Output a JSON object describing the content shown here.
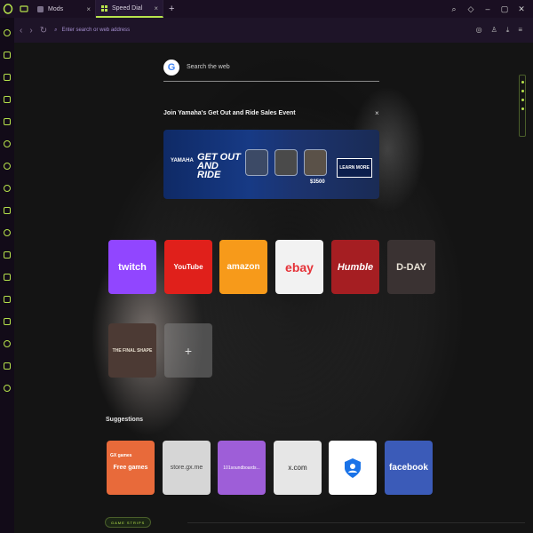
{
  "tabs": [
    {
      "title": "Mods",
      "close": "×"
    },
    {
      "title": "Speed Dial",
      "close": "×"
    }
  ],
  "new_tab": "+",
  "address_bar": {
    "placeholder": "Enter search or web address"
  },
  "search": {
    "placeholder": "Search the web",
    "engine_letter": "G"
  },
  "ad": {
    "title": "Join Yamaha's Get Out and Ride Sales Event",
    "close": "×",
    "brand": "YAMAHA",
    "headline": "GET OUT AND RIDE",
    "offer": "$3500",
    "cta": "LEARN MORE"
  },
  "speed_dial": [
    {
      "label": "twitch",
      "bg": "#9146ff",
      "color": "#ffffff"
    },
    {
      "label": "YouTube",
      "bg": "#e0201b",
      "color": "#ffffff"
    },
    {
      "label": "amazon",
      "bg": "#f79a1a",
      "color": "#ffffff"
    },
    {
      "label": "ebay",
      "bg": "#f2f2f2",
      "color": "#e53238"
    },
    {
      "label": "Humble",
      "bg": "#a51e22",
      "color": "#ffffff"
    },
    {
      "label": "D-DAY",
      "bg": "#3a3232",
      "color": "#e8e2d6"
    },
    {
      "label": "THE FINAL SHAPE",
      "bg": "#4c3a34",
      "color": "#e9e0d0"
    }
  ],
  "add_tile": "+",
  "suggestions_label": "Suggestions",
  "suggestions": [
    {
      "label": "Free games",
      "bg": "#e86a3a",
      "color": "#ffffff"
    },
    {
      "label": "store.gx.me",
      "bg": "#d6d6d6",
      "color": "#444444"
    },
    {
      "label": "101soundboards...",
      "bg": "#9e5ed8",
      "color": "#ffffff"
    },
    {
      "label": "x.com",
      "bg": "#e6e6e6",
      "color": "#222222"
    },
    {
      "label": "",
      "bg": "#ffffff",
      "color": "#1a73e8"
    },
    {
      "label": "facebook",
      "bg": "#3b5bb8",
      "color": "#ffffff"
    }
  ],
  "gx_games_badge": "GX games",
  "footer_label": "GAME STRIPS",
  "colors": {
    "accent": "#b7e34c",
    "tab_bg": "#1a0f22"
  }
}
